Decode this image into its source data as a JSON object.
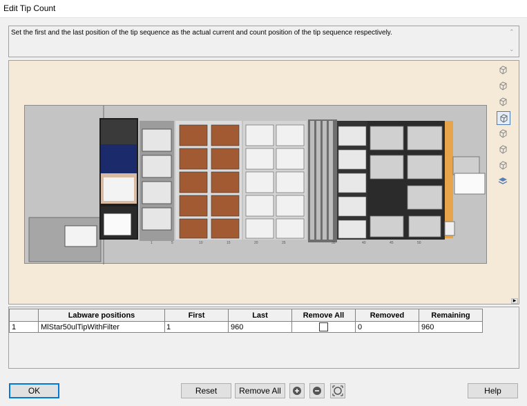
{
  "window": {
    "title": "Edit Tip Count"
  },
  "description": "Set the first and the last position of the tip sequence as the actual  current and count position of the tip sequence respectively.",
  "deck": {
    "position_labels": [
      "1",
      "5",
      "10",
      "15",
      "20",
      "25",
      "35",
      "40",
      "45",
      "50"
    ]
  },
  "toolbar_icons": [
    "view-cube-1-icon",
    "view-cube-2-icon",
    "view-cube-3-icon",
    "view-cube-4-icon",
    "view-cube-5-icon",
    "view-cube-6-icon",
    "view-cube-7-icon",
    "layers-icon"
  ],
  "table": {
    "headers": [
      "",
      "Labware positions",
      "First",
      "Last",
      "Remove All",
      "Removed",
      "Remaining"
    ],
    "rows": [
      {
        "index": "1",
        "labware": "MlStar50ulTipWithFilter",
        "first": "1",
        "last": "960",
        "remove_all": false,
        "removed": "0",
        "remaining": "960"
      }
    ]
  },
  "buttons": {
    "ok": "OK",
    "reset": "Reset",
    "remove_all": "Remove All",
    "help": "Help"
  },
  "icon_buttons": [
    "zoom-in-icon",
    "zoom-out-icon",
    "fit-view-icon"
  ]
}
